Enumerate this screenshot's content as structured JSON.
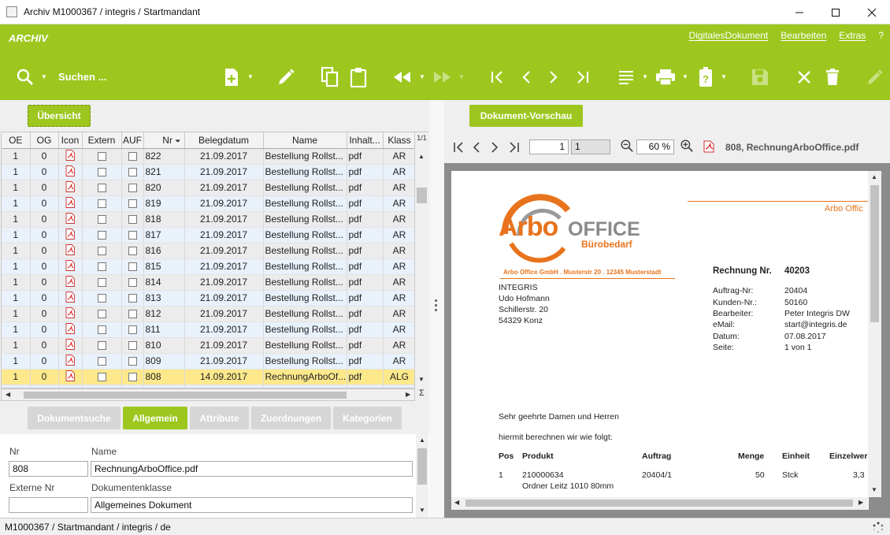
{
  "window": {
    "title": "Archiv M1000367 / integris / Startmandant"
  },
  "module": {
    "title": "ARCHIV"
  },
  "menu": {
    "items": [
      "DigitalesDokument",
      "Bearbeiten",
      "Extras",
      "?"
    ]
  },
  "toolbar": {
    "search_label": "Suchen ..."
  },
  "left": {
    "overview_tab": "Übersicht",
    "grid": {
      "columns": [
        "OE",
        "OG",
        "Icon",
        "Extern",
        "AUF",
        "Nr",
        "Belegdatum",
        "Name",
        "Inhalt...",
        "Klass"
      ],
      "page_indicator": "1/1",
      "rows": [
        {
          "oe": "1",
          "og": "0",
          "nr": "822",
          "date": "21.09.2017",
          "name": "Bestellung Rollst...",
          "type": "pdf",
          "klass": "AR"
        },
        {
          "oe": "1",
          "og": "0",
          "nr": "821",
          "date": "21.09.2017",
          "name": "Bestellung Rollst...",
          "type": "pdf",
          "klass": "AR"
        },
        {
          "oe": "1",
          "og": "0",
          "nr": "820",
          "date": "21.09.2017",
          "name": "Bestellung Rollst...",
          "type": "pdf",
          "klass": "AR"
        },
        {
          "oe": "1",
          "og": "0",
          "nr": "819",
          "date": "21.09.2017",
          "name": "Bestellung Rollst...",
          "type": "pdf",
          "klass": "AR"
        },
        {
          "oe": "1",
          "og": "0",
          "nr": "818",
          "date": "21.09.2017",
          "name": "Bestellung Rollst...",
          "type": "pdf",
          "klass": "AR"
        },
        {
          "oe": "1",
          "og": "0",
          "nr": "817",
          "date": "21.09.2017",
          "name": "Bestellung Rollst...",
          "type": "pdf",
          "klass": "AR"
        },
        {
          "oe": "1",
          "og": "0",
          "nr": "816",
          "date": "21.09.2017",
          "name": "Bestellung Rollst...",
          "type": "pdf",
          "klass": "AR"
        },
        {
          "oe": "1",
          "og": "0",
          "nr": "815",
          "date": "21.09.2017",
          "name": "Bestellung Rollst...",
          "type": "pdf",
          "klass": "AR"
        },
        {
          "oe": "1",
          "og": "0",
          "nr": "814",
          "date": "21.09.2017",
          "name": "Bestellung Rollst...",
          "type": "pdf",
          "klass": "AR"
        },
        {
          "oe": "1",
          "og": "0",
          "nr": "813",
          "date": "21.09.2017",
          "name": "Bestellung Rollst...",
          "type": "pdf",
          "klass": "AR"
        },
        {
          "oe": "1",
          "og": "0",
          "nr": "812",
          "date": "21.09.2017",
          "name": "Bestellung Rollst...",
          "type": "pdf",
          "klass": "AR"
        },
        {
          "oe": "1",
          "og": "0",
          "nr": "811",
          "date": "21.09.2017",
          "name": "Bestellung Rollst...",
          "type": "pdf",
          "klass": "AR"
        },
        {
          "oe": "1",
          "og": "0",
          "nr": "810",
          "date": "21.09.2017",
          "name": "Bestellung Rollst...",
          "type": "pdf",
          "klass": "AR"
        },
        {
          "oe": "1",
          "og": "0",
          "nr": "809",
          "date": "21.09.2017",
          "name": "Bestellung Rollst...",
          "type": "pdf",
          "klass": "AR"
        },
        {
          "oe": "1",
          "og": "0",
          "nr": "808",
          "date": "14.09.2017",
          "name": "RechnungArboOf...",
          "type": "pdf",
          "klass": "ALG"
        }
      ],
      "sum_symbol": "Σ"
    },
    "tabs": [
      "Dokumentsuche",
      "Allgemein",
      "Attribute",
      "Zuordnungen",
      "Kategorien"
    ],
    "detail": {
      "nr_label": "Nr",
      "nr_value": "808",
      "name_label": "Name",
      "name_value": "RechnungArboOffice.pdf",
      "extern_label": "Externe Nr",
      "extern_value": "",
      "class_label": "Dokumentenklasse",
      "class_value": "Allgemeines Dokument"
    }
  },
  "right": {
    "preview_tab": "Dokument-Vorschau",
    "viewer": {
      "page_current": "1",
      "page_total": "1",
      "zoom": "60 %",
      "file_label": "808, RechnungArboOffice.pdf"
    },
    "document": {
      "logo_arbo": "Arbo",
      "logo_office": "OFFICE",
      "logo_sub": "Bürobedarf",
      "header_right": "Arbo Offic",
      "sender_line": "Arbo Office GmbH . Musterstr 20 . 12345 Musterstadt",
      "recipient": [
        "INTEGRIS",
        "Udo Hofmann",
        "Schillerstr. 20",
        "54329 Konz"
      ],
      "invoice_label": "Rechnung Nr.",
      "invoice_no": "40203",
      "meta_labels": [
        "Auftrag-Nr:",
        "Kunden-Nr.:",
        "Bearbeiter:",
        "eMail:",
        "Datum:",
        "Seite:"
      ],
      "meta_values": [
        "20404",
        "50160",
        "Peter Integris DW",
        "start@integris.de",
        "07.08.2017",
        "1 von 1"
      ],
      "greeting": "Sehr geehrte Damen und Herren",
      "intro": "hiermit berechnen wir wie folgt:",
      "table_headers": [
        "Pos",
        "Produkt",
        "Auftrag",
        "Menge",
        "Einheit",
        "Einzelwer"
      ],
      "first_row": [
        "1",
        "210000634",
        "20404/1",
        "50",
        "Stck",
        "3,3"
      ],
      "first_row_sub": "Ordner Leitz 1010 80mm"
    }
  },
  "status": {
    "text": "M1000367 / Startmandant / integris / de"
  },
  "colors": {
    "accent": "#9dc71e",
    "selected_row": "#fde98c",
    "logo_orange": "#e8731c",
    "logo_gray": "#888888"
  }
}
